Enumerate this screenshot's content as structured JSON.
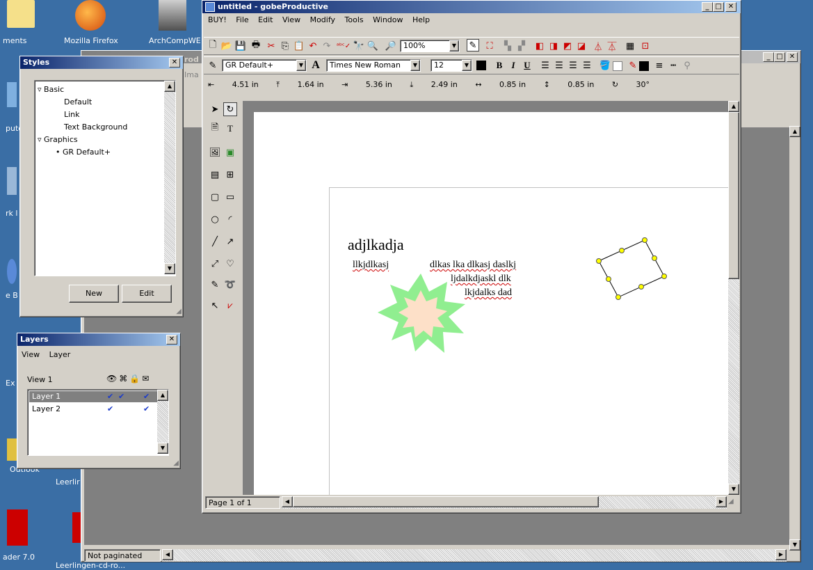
{
  "desktop": {
    "labels": [
      "ments",
      "Mozilla Firefox",
      "ArchCompWE",
      "ader 7.0",
      "Leerlingen-cd-ro...",
      "Leerlir",
      "Outlook",
      "puter",
      "rk l",
      "e B",
      "Ex"
    ]
  },
  "main_window": {
    "title": "untitled - gobeProductive",
    "menu": [
      "BUY!",
      "File",
      "Edit",
      "View",
      "Modify",
      "Tools",
      "Window",
      "Help"
    ],
    "zoom": "100%",
    "style_select": "GR Default+",
    "font_select": "Times New Roman",
    "size_select": "12",
    "ruler": {
      "x": "4.51 in",
      "y": "1.64 in",
      "right": "5.36 in",
      "bottom": "2.49 in",
      "width": "0.85 in",
      "height": "0.85 in",
      "rotation": "30°"
    },
    "status": "Page 1 of 1"
  },
  "document": {
    "heading": "adjlkadja",
    "line1a": "llkjdlkasj",
    "line1b": "dlkas lka dlkasj daslkj",
    "line2": "ljdalkdjaskl dlk",
    "line3": "lkjdalks dad"
  },
  "back_window": {
    "title": "",
    "frag1": "rod",
    "frag2": "Ima",
    "status": "Not paginated"
  },
  "styles_panel": {
    "title": "Styles",
    "tree": [
      {
        "label": "Basic",
        "level": 0,
        "expanded": true
      },
      {
        "label": "Default",
        "level": 1
      },
      {
        "label": "Link",
        "level": 1
      },
      {
        "label": "Text Background",
        "level": 1
      },
      {
        "label": "Graphics",
        "level": 0,
        "expanded": true
      },
      {
        "label": "GR Default+",
        "level": 1,
        "bullet": true
      }
    ],
    "new_label": "New",
    "edit_label": "Edit"
  },
  "layers_panel": {
    "title": "Layers",
    "menu": [
      "View",
      "Layer"
    ],
    "view_label": "View 1",
    "layers": [
      {
        "name": "Layer 1",
        "selected": true,
        "visible": true,
        "print": true,
        "locked": false,
        "active": true
      },
      {
        "name": "Layer 2",
        "selected": false,
        "visible": true,
        "print": false,
        "locked": false,
        "active": true
      }
    ]
  },
  "colors": {
    "desktop": "#3a6ea5",
    "titlebar": "#0a246a",
    "starburst_outer": "#90ee90",
    "starburst_inner": "#fde0c8",
    "handle": "#ffff00"
  }
}
